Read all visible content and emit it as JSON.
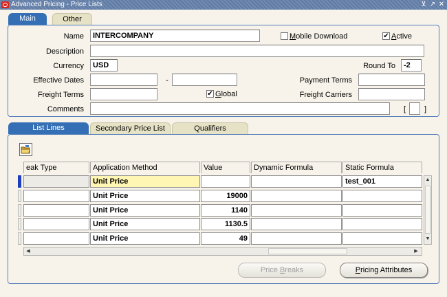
{
  "window": {
    "title": "Advanced Pricing - Price Lists",
    "controls": [
      "⊻",
      "↗",
      "✕"
    ]
  },
  "top_tabs": [
    {
      "label": "Main",
      "active": true
    },
    {
      "label": "Other",
      "active": false
    }
  ],
  "header_form": {
    "name_label": "Name",
    "name_value": "INTERCOMPANY",
    "mobile_download_label": "Mobile Download",
    "mobile_download_checked": false,
    "active_label": "Active",
    "active_checked": true,
    "description_label": "Description",
    "description_value": "",
    "currency_label": "Currency",
    "currency_value": "USD",
    "round_to_label": "Round To",
    "round_to_value": "-2",
    "effective_dates_label": "Effective Dates",
    "date_separator": "-",
    "payment_terms_label": "Payment Terms",
    "freight_terms_label": "Freight Terms",
    "global_label": "Global",
    "global_checked": true,
    "freight_carriers_label": "Freight Carriers",
    "comments_label": "Comments",
    "bracket_open": "[",
    "bracket_close": "]"
  },
  "lower_tabs": [
    {
      "label": "List Lines",
      "active": true
    },
    {
      "label": "Secondary Price List",
      "active": false
    },
    {
      "label": "Qualifiers",
      "active": false
    }
  ],
  "grid": {
    "columns": [
      "eak Type",
      "Application Method",
      "Value",
      "Dynamic Formula",
      "Static Formula"
    ],
    "rows": [
      {
        "break_type": "",
        "application_method": "Unit Price",
        "value": "",
        "dynamic_formula": "",
        "static_formula": "test_001"
      },
      {
        "break_type": "",
        "application_method": "Unit Price",
        "value": "19000",
        "dynamic_formula": "",
        "static_formula": ""
      },
      {
        "break_type": "",
        "application_method": "Unit Price",
        "value": "1140",
        "dynamic_formula": "",
        "static_formula": ""
      },
      {
        "break_type": "",
        "application_method": "Unit Price",
        "value": "1130.5",
        "dynamic_formula": "",
        "static_formula": ""
      },
      {
        "break_type": "",
        "application_method": "Unit Price",
        "value": "49",
        "dynamic_formula": "",
        "static_formula": ""
      }
    ]
  },
  "buttons": {
    "price_breaks": "Price Breaks",
    "pricing_attributes": "Pricing Attributes"
  }
}
